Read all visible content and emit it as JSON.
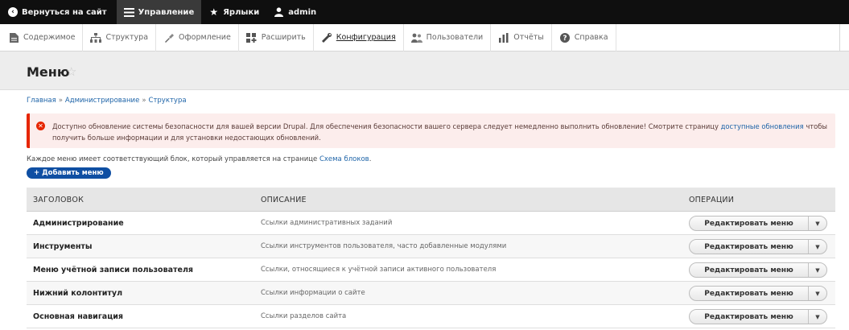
{
  "toolbar": {
    "back_label": "Вернуться на сайт",
    "manage_label": "Управление",
    "shortcuts_label": "Ярлыки",
    "user_label": "admin"
  },
  "admin_menu": {
    "items": [
      {
        "label": "Содержимое",
        "icon": "content-icon"
      },
      {
        "label": "Структура",
        "icon": "structure-icon"
      },
      {
        "label": "Оформление",
        "icon": "appearance-icon"
      },
      {
        "label": "Расширить",
        "icon": "extend-icon"
      },
      {
        "label": "Конфигурация",
        "icon": "configuration-icon"
      },
      {
        "label": "Пользователи",
        "icon": "people-icon"
      },
      {
        "label": "Отчёты",
        "icon": "reports-icon"
      },
      {
        "label": "Справка",
        "icon": "help-icon"
      }
    ],
    "active_index": 4
  },
  "page": {
    "title": "Меню"
  },
  "breadcrumb": {
    "items": [
      "Главная",
      "Администрирование",
      "Структура"
    ],
    "separator": "»"
  },
  "alert": {
    "text_part1": "Доступно обновление системы безопасности для вашей версии Drupal. Для обеспечения безопасности вашего сервера следует немедленно выполнить обновление! Смотрите страницу",
    "link": "доступные обновления",
    "text_part2": "чтобы получить больше информации и для установки недостающих обновлений."
  },
  "intro": {
    "text": "Каждое меню имеет соответствующий блок, который управляется на странице",
    "link": "Схема блоков",
    "tail": "."
  },
  "add_button": "+ Добавить меню",
  "table": {
    "headers": [
      "ЗАГОЛОВОК",
      "ОПИСАНИЕ",
      "ОПЕРАЦИИ"
    ],
    "rows": [
      {
        "title": "Администрирование",
        "description": "Ссылки административных заданий",
        "operation": "Редактировать меню"
      },
      {
        "title": "Инструменты",
        "description": "Ссылки инструментов пользователя, часто добавленные модулями",
        "operation": "Редактировать меню"
      },
      {
        "title": "Меню учётной записи пользователя",
        "description": "Ссылки, относящиеся к учётной записи активного пользователя",
        "operation": "Редактировать меню"
      },
      {
        "title": "Нижний колонтитул",
        "description": "Ссылки информации о сайте",
        "operation": "Редактировать меню"
      },
      {
        "title": "Основная навигация",
        "description": "Ссылки разделов сайта",
        "operation": "Редактировать меню"
      }
    ]
  },
  "colors": {
    "toolbar_bg": "#0f0f0f",
    "link": "#1e64a8",
    "alert_border": "#e62600",
    "alert_bg": "#fcedec",
    "primary_button": "#0f4fa3"
  }
}
